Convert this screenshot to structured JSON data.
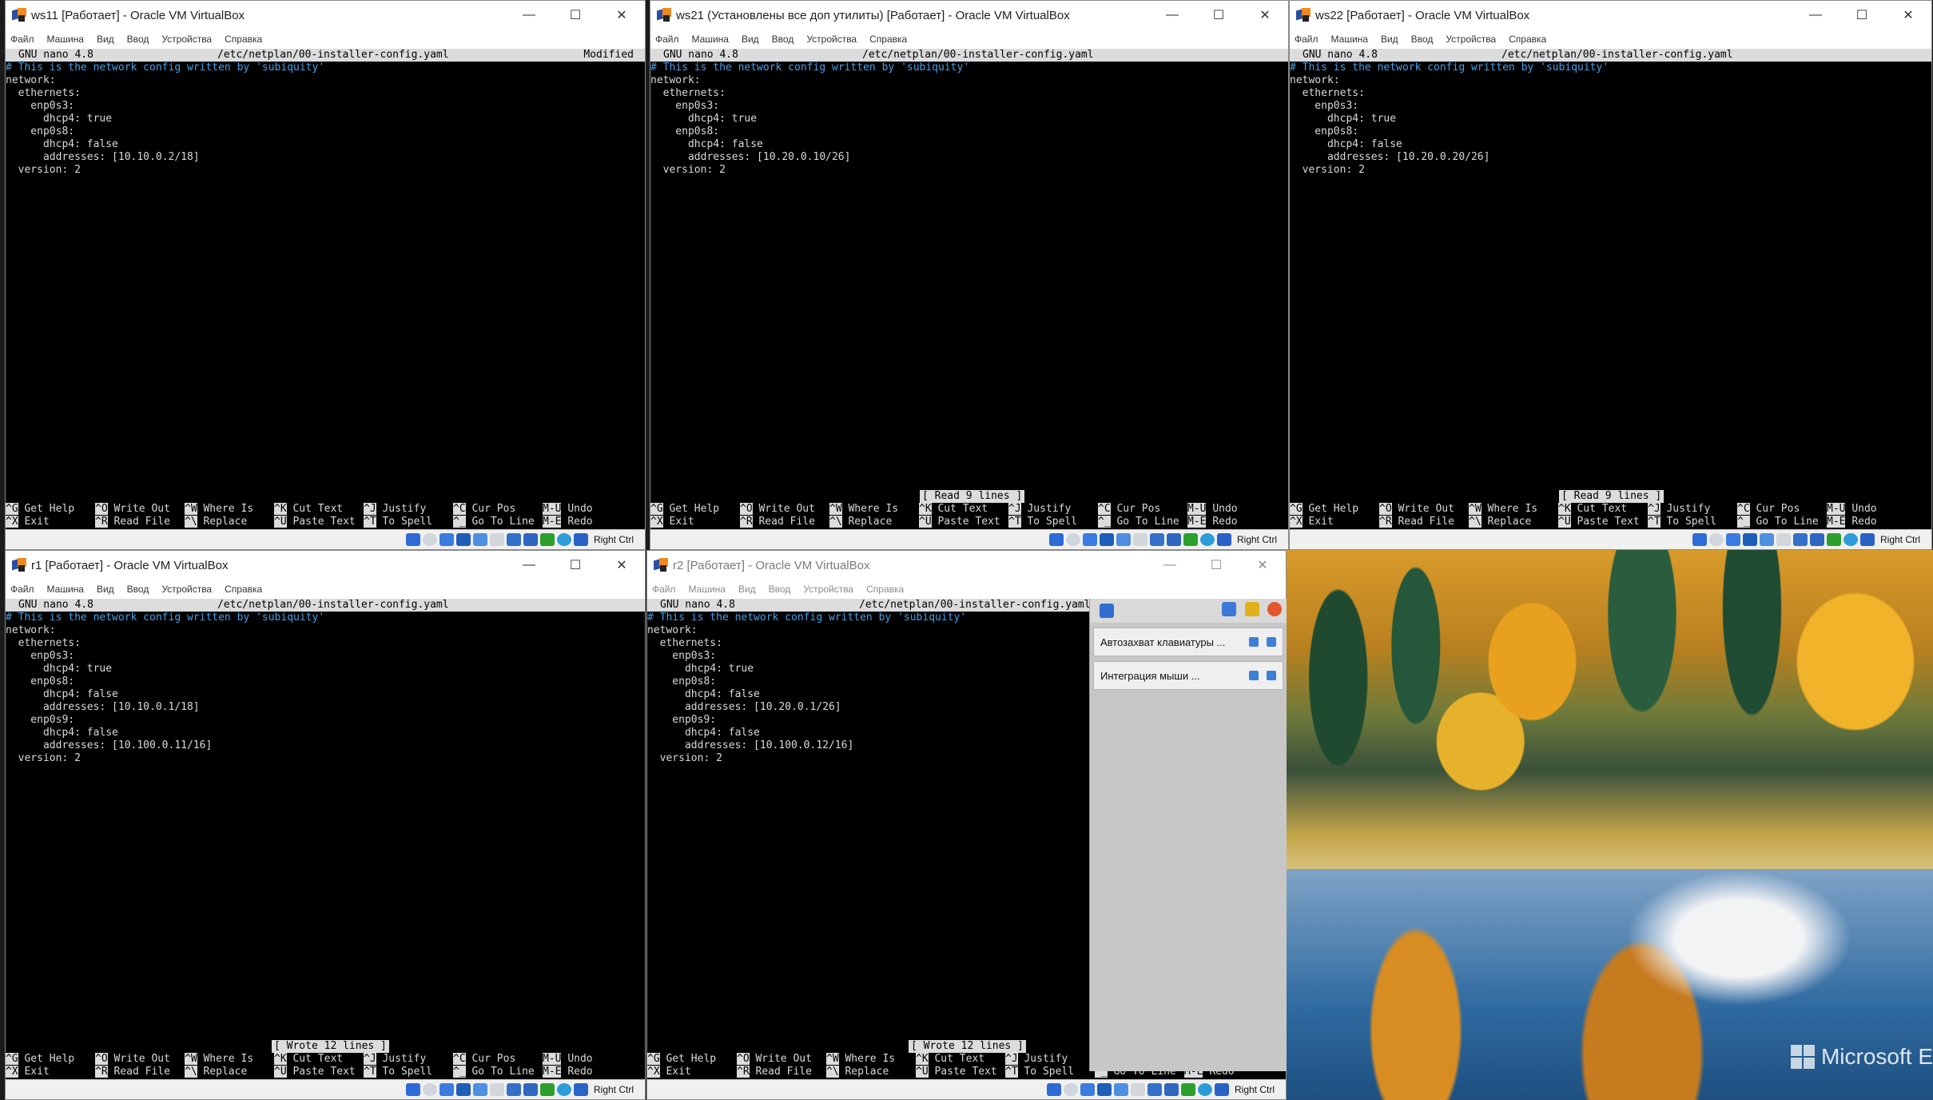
{
  "desktop": {
    "watermark": "Microsoft E"
  },
  "menu_labels": [
    "Файл",
    "Машина",
    "Вид",
    "Ввод",
    "Устройства",
    "Справка"
  ],
  "status": {
    "host_key": "Right Ctrl"
  },
  "colors": {
    "terminal_bg": "#000000",
    "comment": "#3fa0e8",
    "nano_bar": "#dcdcdc"
  },
  "windows": {
    "ws11": {
      "title": "ws11 [Работает] - Oracle VM VirtualBox",
      "nano_version": "GNU nano 4.8",
      "file": "/etc/netplan/00-installer-config.yaml",
      "modified": "Modified",
      "comment": "# This is the network config written by 'subiquity'",
      "lines": [
        "network:",
        "  ethernets:",
        "    enp0s3:",
        "      dhcp4: true",
        "    enp0s8:",
        "      dhcp4: false",
        "      addresses: [10.10.0.2/18]",
        "  version: 2"
      ]
    },
    "ws21": {
      "title": "ws21 (Установлены все доп утилиты) [Работает] - Oracle VM VirtualBox",
      "nano_version": "GNU nano 4.8",
      "file": "/etc/netplan/00-installer-config.yaml",
      "comment": "# This is the network config written by 'subiquity'",
      "lines": [
        "network:",
        "  ethernets:",
        "    enp0s3:",
        "      dhcp4: true",
        "    enp0s8:",
        "      dhcp4: false",
        "      addresses: [10.20.0.10/26]",
        "  version: 2"
      ],
      "message": "[ Read 9 lines ]"
    },
    "ws22": {
      "title": "ws22 [Работает] - Oracle VM VirtualBox",
      "nano_version": "GNU nano 4.8",
      "file": "/etc/netplan/00-installer-config.yaml",
      "comment": "# This is the network config written by 'subiquity'",
      "lines": [
        "network:",
        "  ethernets:",
        "    enp0s3:",
        "      dhcp4: true",
        "    enp0s8:",
        "      dhcp4: false",
        "      addresses: [10.20.0.20/26]",
        "  version: 2"
      ],
      "message": "[ Read 9 lines ]"
    },
    "r1": {
      "title": "r1 [Работает] - Oracle VM VirtualBox",
      "nano_version": "GNU nano 4.8",
      "file": "/etc/netplan/00-installer-config.yaml",
      "comment": "# This is the network config written by 'subiquity'",
      "lines": [
        "network:",
        "  ethernets:",
        "    enp0s3:",
        "      dhcp4: true",
        "    enp0s8:",
        "      dhcp4: false",
        "      addresses: [10.10.0.1/18]",
        "    enp0s9:",
        "      dhcp4: false",
        "      addresses: [10.100.0.11/16]",
        "  version: 2"
      ],
      "message": "[ Wrote 12 lines ]"
    },
    "r2": {
      "title": "r2 [Работает] - Oracle VM VirtualBox",
      "nano_version": "GNU nano 4.8",
      "file": "/etc/netplan/00-installer-config.yaml",
      "comment": "# This is the network config written by 'subiquity'",
      "lines": [
        "network:",
        "  ethernets:",
        "    enp0s3:",
        "      dhcp4: true",
        "    enp0s8:",
        "      dhcp4: false",
        "      addresses: [10.20.0.1/26]",
        "    enp0s9:",
        "      dhcp4: false",
        "      addresses: [10.100.0.12/16]",
        "  version: 2"
      ],
      "message": "[ Wrote 12 lines ]"
    }
  },
  "shortcuts": {
    "row1": [
      {
        "key": "^G",
        "label": "Get Help"
      },
      {
        "key": "^O",
        "label": "Write Out"
      },
      {
        "key": "^W",
        "label": "Where Is"
      },
      {
        "key": "^K",
        "label": "Cut Text"
      },
      {
        "key": "^J",
        "label": "Justify"
      },
      {
        "key": "^C",
        "label": "Cur Pos"
      },
      {
        "key": "M-U",
        "label": "Undo"
      }
    ],
    "row2": [
      {
        "key": "^X",
        "label": "Exit"
      },
      {
        "key": "^R",
        "label": "Read File"
      },
      {
        "key": "^\\",
        "label": "Replace"
      },
      {
        "key": "^U",
        "label": "Paste Text"
      },
      {
        "key": "^T",
        "label": "To Spell"
      },
      {
        "key": "^_",
        "label": "Go To Line"
      },
      {
        "key": "M-E",
        "label": "Redo"
      }
    ]
  },
  "notifications": {
    "items": [
      {
        "text": "Автозахват клавиатуры ..."
      },
      {
        "text": "Интеграция мыши ..."
      }
    ]
  }
}
